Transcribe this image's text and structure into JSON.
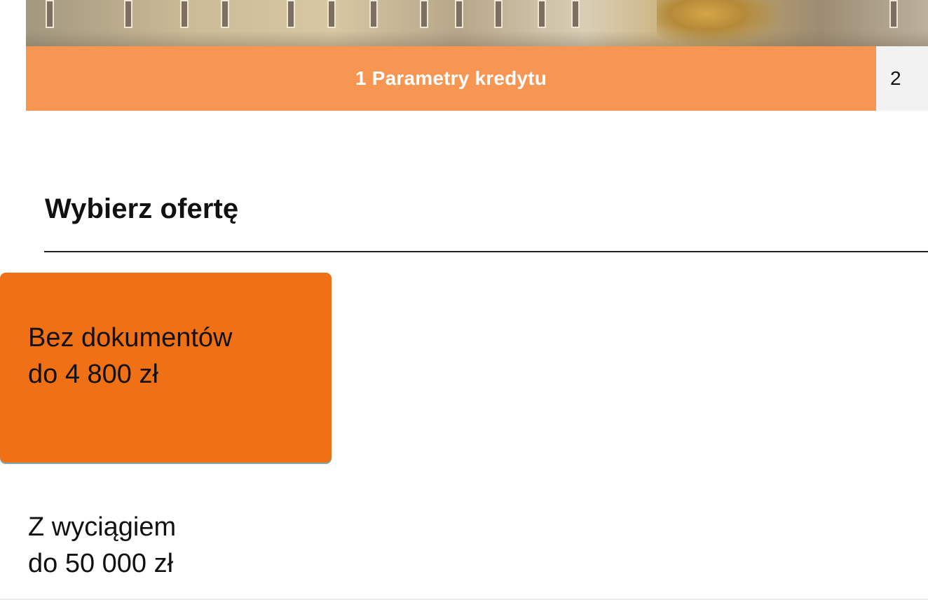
{
  "steps": {
    "active": {
      "number": "1",
      "label": "Parametry kredytu"
    },
    "next": {
      "number": "2"
    }
  },
  "section": {
    "title": "Wybierz ofertę"
  },
  "offers": [
    {
      "line1": "Bez dokumentów",
      "line2": "do 4 800 zł",
      "selected": true
    },
    {
      "line1": "Z wyciągiem",
      "line2": "do 50 000 zł",
      "selected": false
    }
  ],
  "colors": {
    "accent": "#f07016",
    "step_active_bg": "#f69652",
    "step_inactive_bg": "#f2f2f2"
  },
  "icons": {
    "hero": "building-photo"
  }
}
